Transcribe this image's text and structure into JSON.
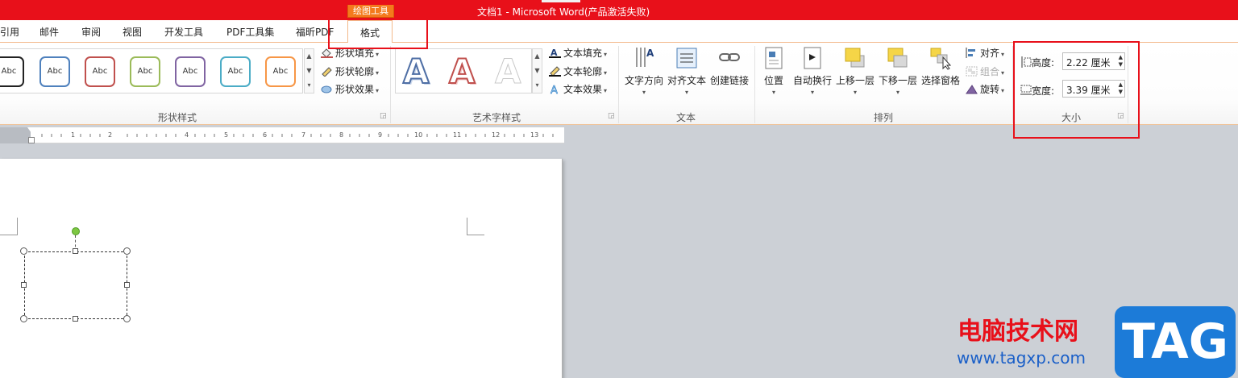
{
  "window": {
    "title": "文档1 - Microsoft Word(产品激活失败)",
    "context_tab_label": "绘图工具"
  },
  "tabs": [
    {
      "label": "引用"
    },
    {
      "label": "邮件"
    },
    {
      "label": "审阅"
    },
    {
      "label": "视图"
    },
    {
      "label": "开发工具"
    },
    {
      "label": "PDF工具集"
    },
    {
      "label": "福昕PDF"
    },
    {
      "label": "格式",
      "active": true
    }
  ],
  "ribbon": {
    "shape_styles": {
      "label": "形状样式",
      "swatch_text": "Abc",
      "swatch_colors": [
        "#222222",
        "#4f81bd",
        "#c0504d",
        "#9bbb59",
        "#8064a2",
        "#4bacc6",
        "#f79646"
      ],
      "fill": "形状填充",
      "outline": "形状轮廓",
      "effects": "形状效果"
    },
    "wordart": {
      "label": "艺术字样式",
      "letter": "A",
      "fill": "文本填充",
      "outline": "文本轮廓",
      "effects": "文本效果"
    },
    "text": {
      "label": "文本",
      "direction": "文字方向",
      "align": "对齐文本",
      "link": "创建链接"
    },
    "arrange": {
      "label": "排列",
      "position": "位置",
      "wrap": "自动换行",
      "bring_forward": "上移一层",
      "send_backward": "下移一层",
      "selection_pane": "选择窗格",
      "align": "对齐",
      "group": "组合",
      "rotate": "旋转"
    },
    "size": {
      "label": "大小",
      "height_label": "高度:",
      "height_value": "2.22 厘米",
      "width_label": "宽度:",
      "width_value": "3.39 厘米"
    }
  },
  "ruler": {
    "numbers": [
      "1",
      "2",
      "4",
      "5",
      "6",
      "7",
      "8",
      "9",
      "10",
      "11",
      "12",
      "13"
    ]
  },
  "watermark": {
    "site_name": "电脑技术网",
    "url": "www.tagxp.com",
    "logo": "TAG"
  },
  "colors": {
    "title_bar": "#e8101a",
    "context_tab": "#f47a1d",
    "highlight": "#e8101a",
    "rotation_handle": "#7dc742"
  }
}
